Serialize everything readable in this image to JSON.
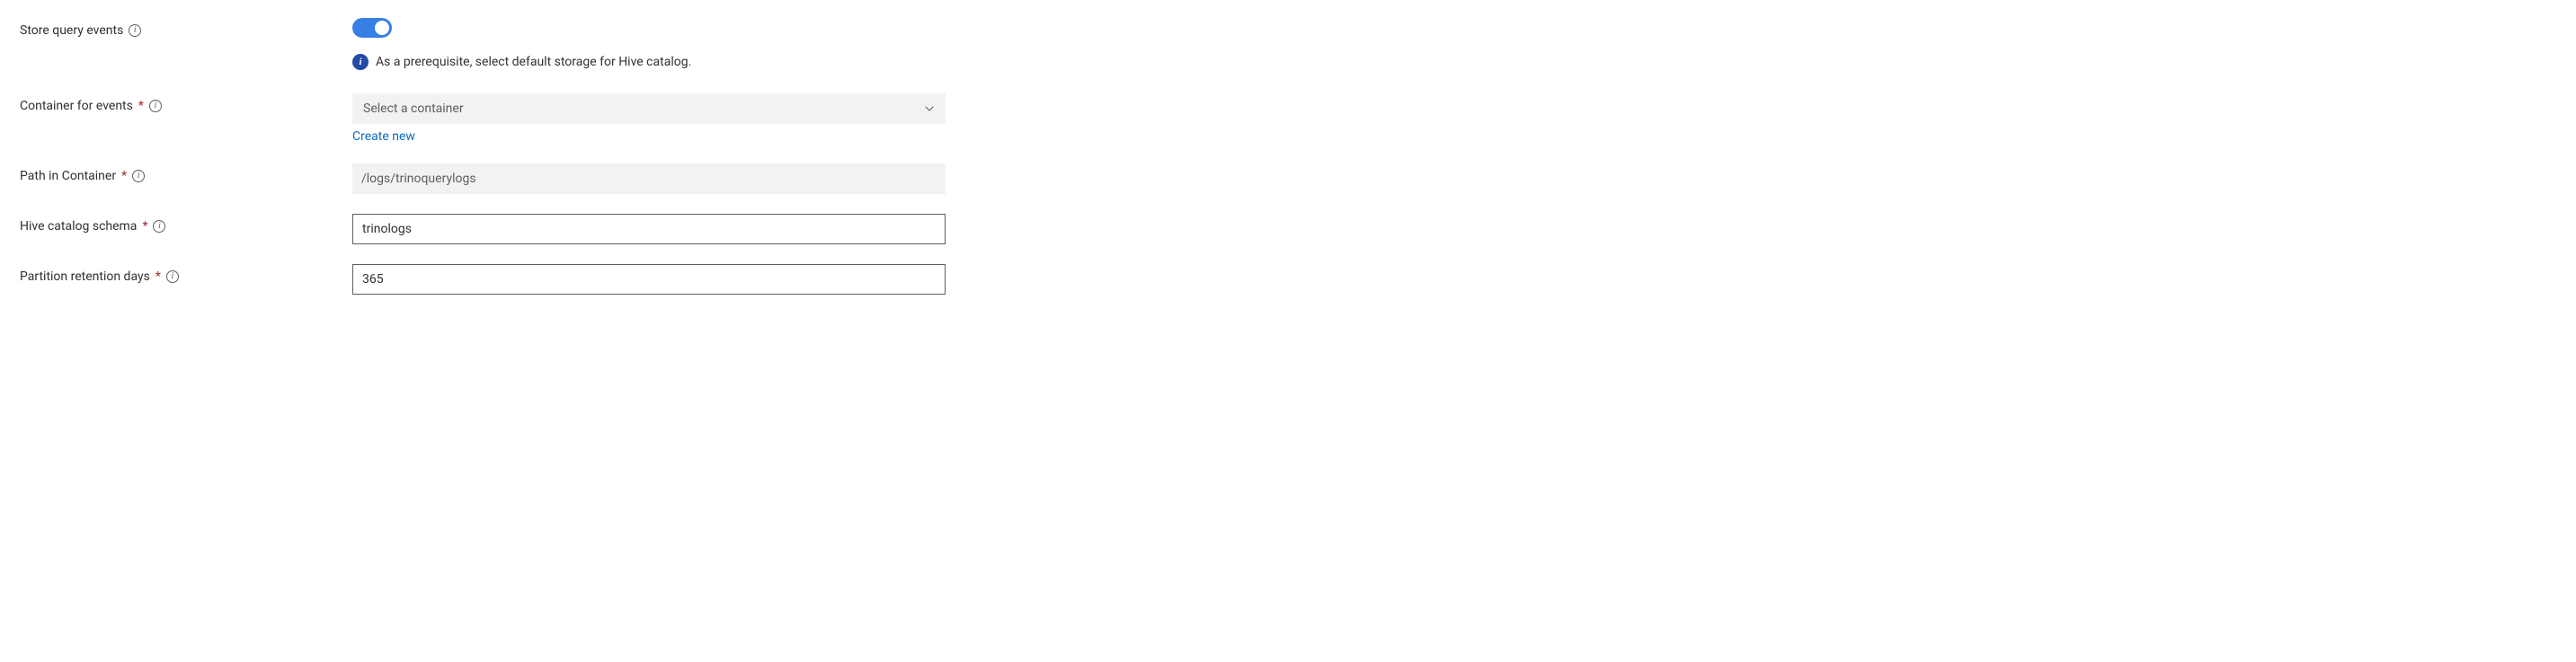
{
  "fields": {
    "store_query_events": {
      "label": "Store query events",
      "enabled": true,
      "hint": "As a prerequisite, select default storage for Hive catalog."
    },
    "container_for_events": {
      "label": "Container for events",
      "required": true,
      "placeholder": "Select a container",
      "create_new_label": "Create new"
    },
    "path_in_container": {
      "label": "Path in Container",
      "required": true,
      "placeholder": "/logs/trinoquerylogs",
      "value": ""
    },
    "hive_catalog_schema": {
      "label": "Hive catalog schema",
      "required": true,
      "value": "trinologs"
    },
    "partition_retention_days": {
      "label": "Partition retention days",
      "required": true,
      "value": "365"
    }
  }
}
